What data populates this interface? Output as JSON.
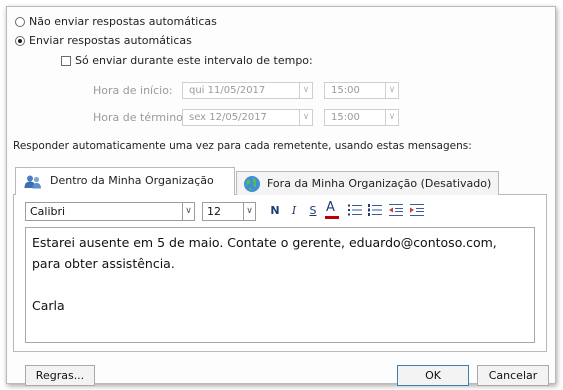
{
  "options": {
    "no_auto_reply": "Não enviar respostas automáticas",
    "send_auto_reply": "Enviar respostas automáticas",
    "time_range_checkbox": "Só enviar durante este intervalo de tempo:"
  },
  "schedule": {
    "start_label": "Hora de início:",
    "start_date": "qui 11/05/2017",
    "start_time": "15:00",
    "end_label": "Hora de término:",
    "end_date": "sex 12/05/2017",
    "end_time": "15:00"
  },
  "instruction": "Responder automaticamente uma vez para cada remetente, usando estas mensagens:",
  "tabs": [
    {
      "label": "Dentro da Minha Organização",
      "icon": "people-icon",
      "selected": true
    },
    {
      "label": "Fora da Minha Organização (Desativado)",
      "icon": "globe-icon",
      "selected": false
    }
  ],
  "toolbar": {
    "font": "Calibri",
    "size": "12",
    "bold": "N",
    "italic": "I",
    "underline": "S",
    "font_color": "A"
  },
  "message": {
    "line1": "Estarei ausente em 5 de maio. Contate o gerente, eduardo@contoso.com,",
    "line2": "para obter assistência.",
    "line3": "",
    "line4": "Carla"
  },
  "buttons": {
    "rules": "Regras...",
    "ok": "OK",
    "cancel": "Cancelar"
  },
  "colors": {
    "accent": "#1f3b73",
    "font_color_bar": "#c00000"
  }
}
